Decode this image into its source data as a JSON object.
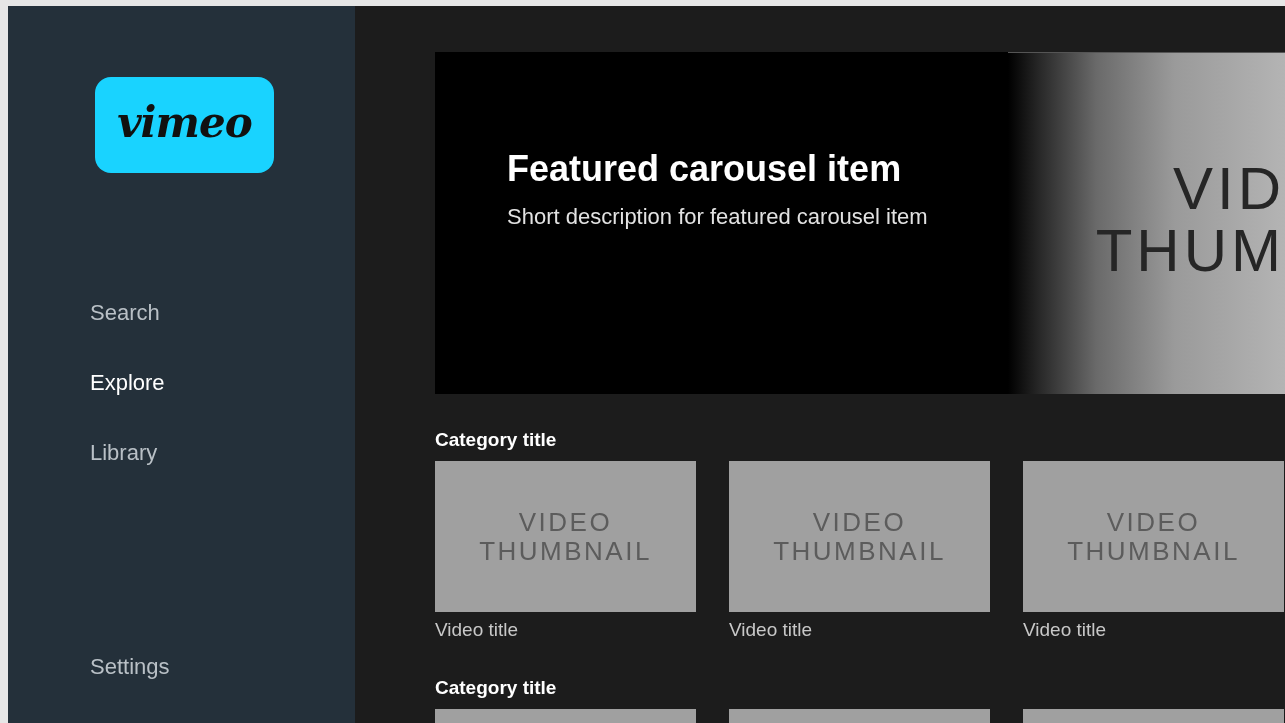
{
  "sidebar": {
    "logo": "vimeo",
    "nav_items": [
      {
        "label": "Search",
        "selected": false
      },
      {
        "label": "Explore",
        "selected": true
      },
      {
        "label": "Library",
        "selected": false
      }
    ],
    "footer_item": {
      "label": "Settings",
      "selected": false
    }
  },
  "carousel": {
    "title": "Featured carousel item",
    "description": "Short description for featured carousel item",
    "next_thumbnail_lines": [
      "VID",
      "THUM"
    ]
  },
  "categories": [
    {
      "title": "Category title",
      "videos": [
        {
          "kind": "thumbnail",
          "placeholder_lines": [
            "VIDEO",
            "THUMBNAIL"
          ],
          "title": "Video title"
        },
        {
          "kind": "thumbnail",
          "placeholder_lines": [
            "VIDEO",
            "THUMBNAIL"
          ],
          "title": "Video title"
        },
        {
          "kind": "thumbnail",
          "placeholder_lines": [
            "VIDEO",
            "THUMBNAIL"
          ],
          "title": "Video title"
        }
      ]
    },
    {
      "title": "Category title",
      "videos": [
        {
          "kind": "thumbnail"
        },
        {
          "kind": "thumbnail"
        },
        {
          "kind": "thumbnail"
        }
      ]
    }
  ]
}
